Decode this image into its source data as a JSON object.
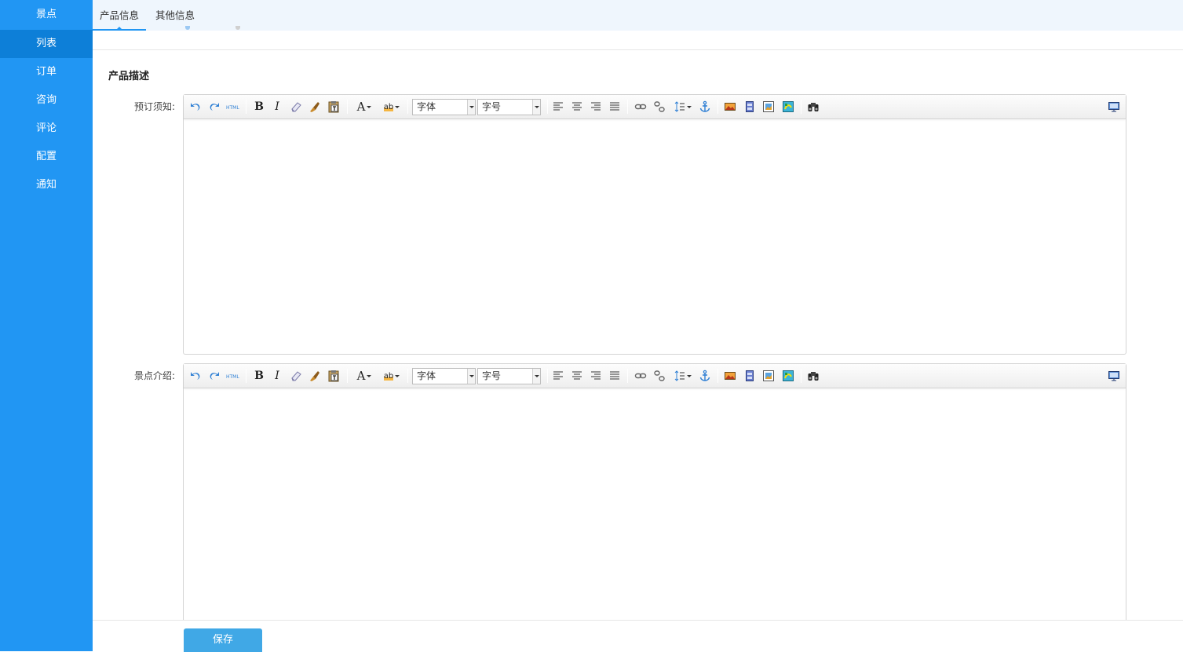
{
  "sidebar": {
    "title": "景点",
    "items": [
      {
        "label": "列表",
        "active": true
      },
      {
        "label": "订单"
      },
      {
        "label": "咨询"
      },
      {
        "label": "评论"
      },
      {
        "label": "配置"
      },
      {
        "label": "通知"
      }
    ]
  },
  "tabs": [
    {
      "label": "产品信息",
      "active": true
    },
    {
      "label": "其他信息"
    }
  ],
  "section_title": "产品描述",
  "editors": [
    {
      "label": "预订须知:",
      "font_placeholder": "字体",
      "size_placeholder": "字号",
      "content": ""
    },
    {
      "label": "景点介绍:",
      "font_placeholder": "字体",
      "size_placeholder": "字号",
      "content": ""
    }
  ],
  "toolbar": {
    "html_label": "HTML",
    "bold": "B",
    "italic": "I",
    "fontcolor": "A",
    "backcolor": "ab"
  },
  "save_label": "保存",
  "colors": {
    "sidebar": "#2196f3",
    "sidebar_active": "#0d7fd8",
    "tabbar": "#eff6fd",
    "button": "#40a8e6"
  }
}
